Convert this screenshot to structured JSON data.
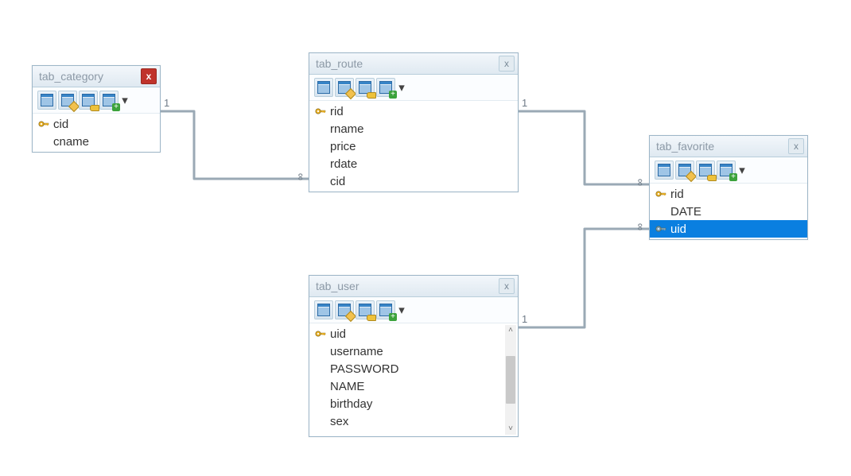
{
  "tables": {
    "category": {
      "title": "tab_category",
      "close_variant": "red",
      "fields": [
        {
          "name": "cid",
          "key": "pk"
        },
        {
          "name": "cname",
          "key": "none"
        }
      ]
    },
    "route": {
      "title": "tab_route",
      "close_variant": "grey",
      "fields": [
        {
          "name": "rid",
          "key": "pk"
        },
        {
          "name": "rname",
          "key": "none"
        },
        {
          "name": "price",
          "key": "none"
        },
        {
          "name": "rdate",
          "key": "none"
        },
        {
          "name": "cid",
          "key": "none"
        }
      ]
    },
    "favorite": {
      "title": "tab_favorite",
      "close_variant": "grey",
      "fields": [
        {
          "name": "rid",
          "key": "pk"
        },
        {
          "name": "DATE",
          "key": "none"
        },
        {
          "name": "uid",
          "key": "fk",
          "selected": true
        }
      ]
    },
    "user": {
      "title": "tab_user",
      "close_variant": "grey",
      "scroll": true,
      "fields": [
        {
          "name": "uid",
          "key": "pk"
        },
        {
          "name": "username",
          "key": "none"
        },
        {
          "name": "PASSWORD",
          "key": "none"
        },
        {
          "name": "NAME",
          "key": "none"
        },
        {
          "name": "birthday",
          "key": "none"
        },
        {
          "name": "sex",
          "key": "none"
        }
      ]
    }
  },
  "relations": [
    {
      "from": "category",
      "to": "route",
      "card_from": "1",
      "card_to": "∞"
    },
    {
      "from": "route",
      "to": "favorite",
      "card_from": "1",
      "card_to": "∞"
    },
    {
      "from": "user",
      "to": "favorite",
      "card_from": "1",
      "card_to": "∞"
    }
  ],
  "icons": {
    "key_color_pk": "#e9b22b",
    "key_color_fk": "#8fa7b5"
  },
  "labels": {
    "one": "1",
    "many": "∞"
  }
}
